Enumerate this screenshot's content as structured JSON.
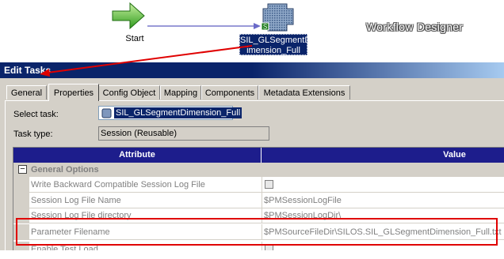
{
  "canvas": {
    "start_label": "Start",
    "session_label": "SIL_GLSegmentD imension_Full",
    "designer_title": "Workflow Designer"
  },
  "dialog": {
    "title": "Edit Tasks",
    "tabs": [
      {
        "label": "General",
        "active": false
      },
      {
        "label": "Properties",
        "active": true
      },
      {
        "label": "Config Object",
        "active": false
      },
      {
        "label": "Mapping",
        "active": false
      },
      {
        "label": "Components",
        "active": false
      },
      {
        "label": "Metadata Extensions",
        "active": false
      }
    ],
    "select_task_label": "Select task:",
    "select_task_value": "SIL_GLSegmentDimension_Full",
    "task_type_label": "Task type:",
    "task_type_value": "Session (Reusable)"
  },
  "grid": {
    "header_attribute": "Attribute",
    "header_value": "Value",
    "group_label": "General Options",
    "rows": [
      {
        "attribute": "Write Backward Compatible Session Log File",
        "value": "",
        "checkbox": true
      },
      {
        "attribute": "Session Log File Name",
        "value": "$PMSessionLogFile",
        "checkbox": false
      },
      {
        "attribute": "Session Log File directory",
        "value": "$PMSessionLogDir\\",
        "checkbox": false
      },
      {
        "attribute": "Parameter Filename",
        "value": "$PMSourceFileDir\\SILOS.SIL_GLSegmentDimension_Full.txt",
        "checkbox": false
      },
      {
        "attribute": "Enable Test Load",
        "value": "",
        "checkbox": true
      }
    ]
  },
  "colors": {
    "title_bar": "#0a246a",
    "grid_header": "#1d1d8c",
    "annotation": "#e00000",
    "dialog_bg": "#d4d0c8"
  }
}
